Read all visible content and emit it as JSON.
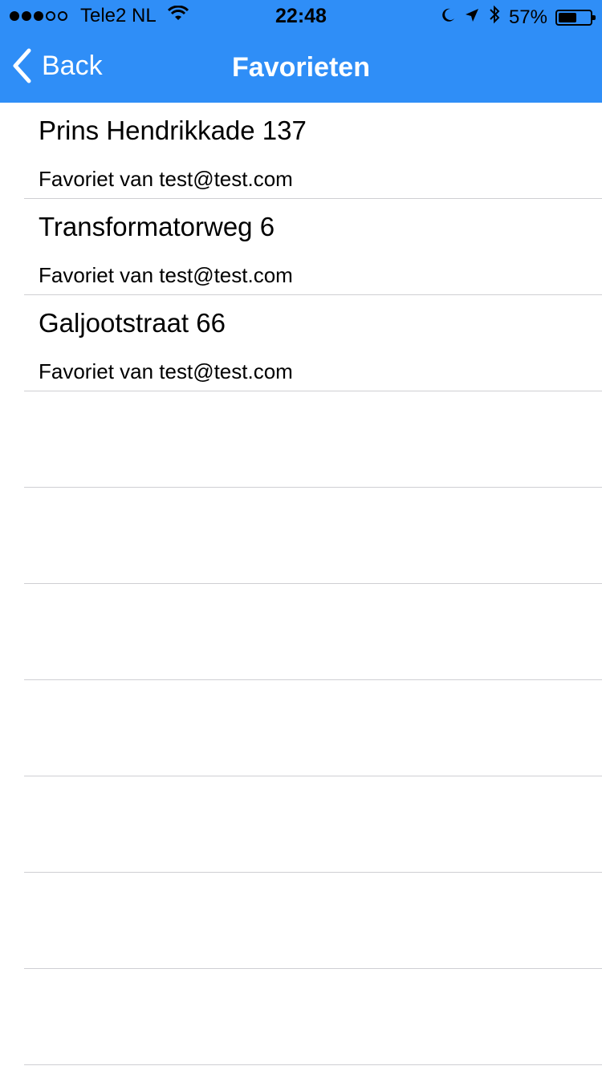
{
  "status_bar": {
    "signal_dots": [
      "full",
      "full",
      "full",
      "empty",
      "empty"
    ],
    "carrier": "Tele2 NL",
    "time": "22:48",
    "battery_percent_text": "57%",
    "battery_level": 0.57,
    "icons": [
      "wifi-icon",
      "moon-icon",
      "location-arrow-icon",
      "bluetooth-icon",
      "battery-icon"
    ]
  },
  "nav": {
    "back_label": "Back",
    "title": "Favorieten"
  },
  "favorites": [
    {
      "address": "Prins Hendrikkade 137",
      "subtitle": "Favoriet van test@test.com"
    },
    {
      "address": "Transformatorweg 6",
      "subtitle": "Favoriet van test@test.com"
    },
    {
      "address": "Galjootstraat 66",
      "subtitle": "Favoriet van test@test.com"
    }
  ],
  "colors": {
    "nav_bar": "#2f8ef7",
    "separator": "#cfcfd3"
  }
}
